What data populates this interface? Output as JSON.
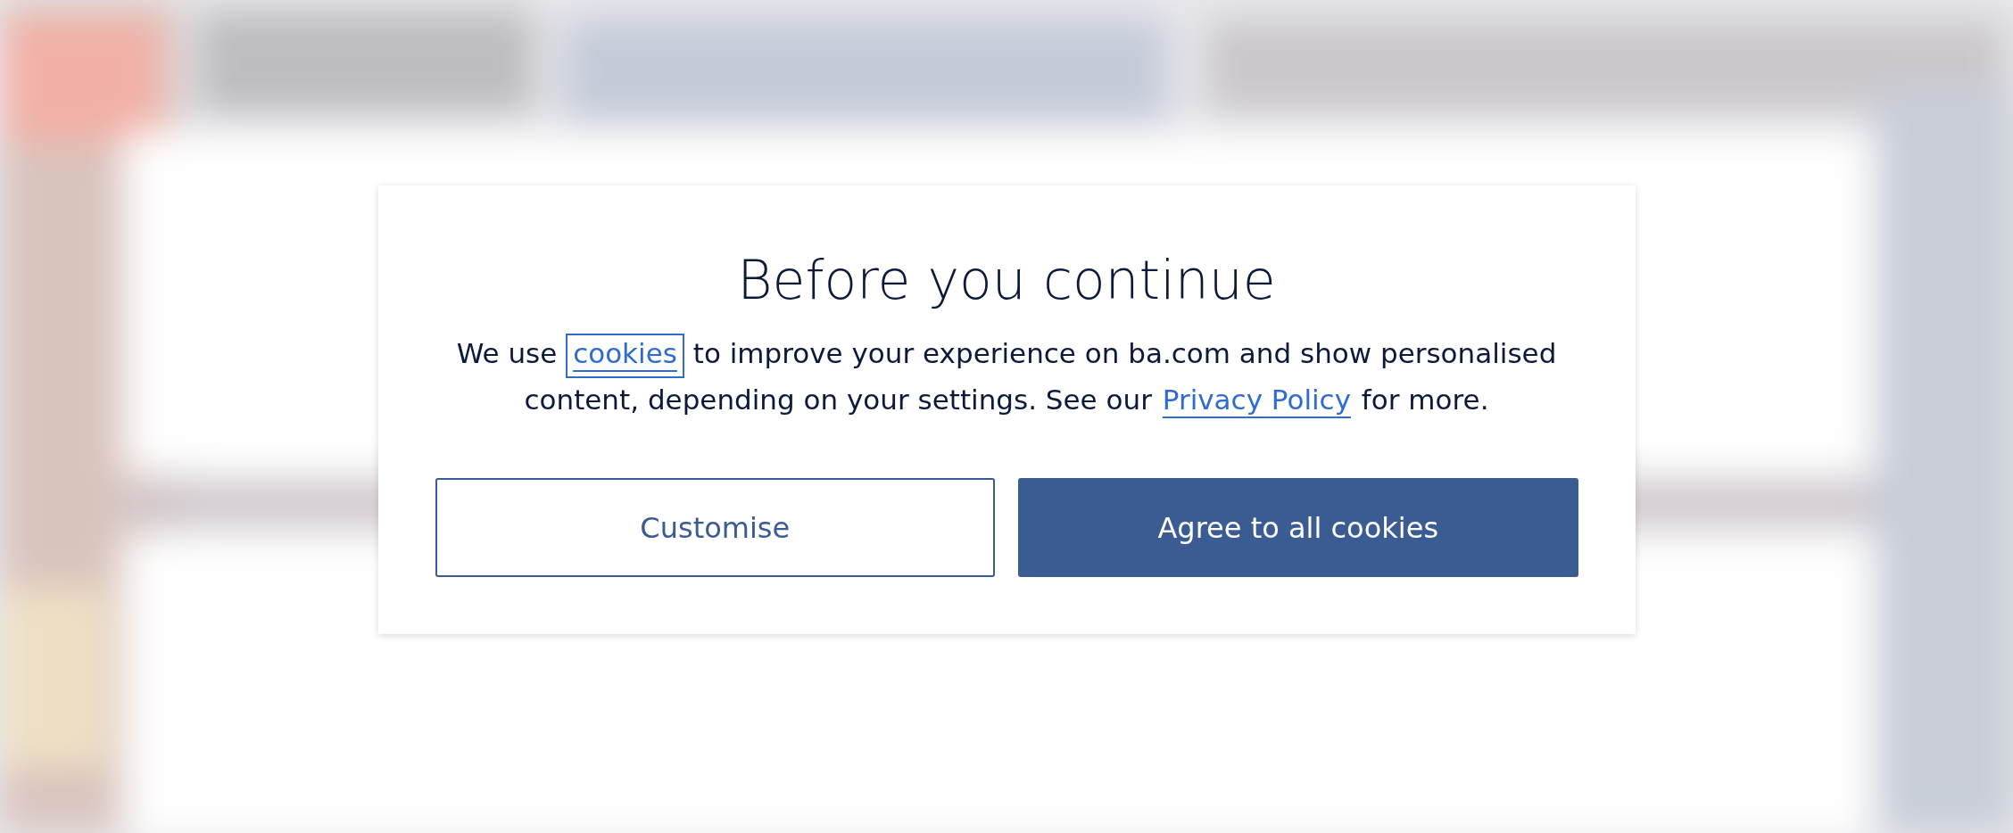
{
  "dialog": {
    "title": "Before you continue",
    "message": [
      {
        "kind": "text",
        "text": "We use "
      },
      {
        "kind": "link",
        "text": "cookies",
        "focused": true
      },
      {
        "kind": "text",
        "text": " to improve your experience on ba.com and show personalised content, depending on your settings. See our "
      },
      {
        "kind": "link",
        "text": "Privacy Policy",
        "focused": false
      },
      {
        "kind": "text",
        "text": " for more."
      }
    ],
    "buttons": [
      {
        "kind": "secondary",
        "label": "Customise"
      },
      {
        "kind": "primary",
        "label": "Agree to all cookies"
      }
    ]
  }
}
